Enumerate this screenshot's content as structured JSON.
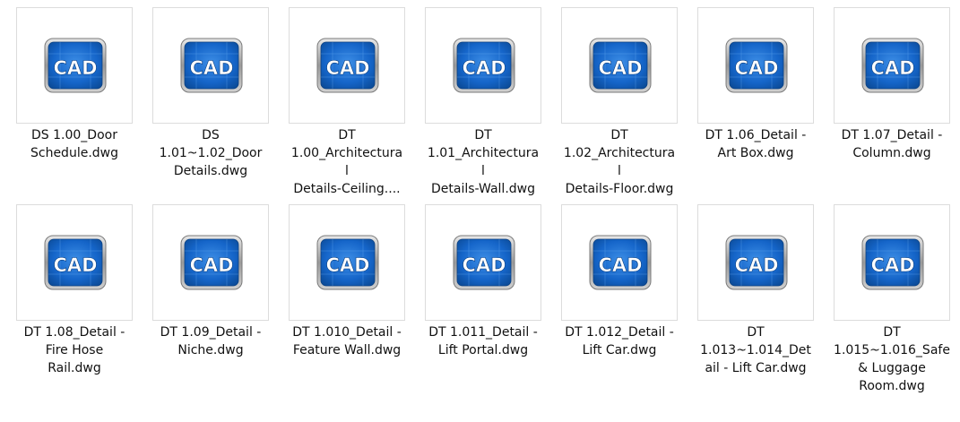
{
  "icon": {
    "name": "cad-file-icon",
    "text": "CAD",
    "color": "#1565c9"
  },
  "files": [
    {
      "lines": [
        "DS 1.00_Door",
        "Schedule.dwg"
      ]
    },
    {
      "lines": [
        "DS",
        "1.01~1.02_Door",
        "Details.dwg"
      ]
    },
    {
      "lines": [
        "DT",
        "1.00_Architectura",
        "l",
        "Details-Ceiling...."
      ]
    },
    {
      "lines": [
        "DT",
        "1.01_Architectura",
        "l",
        "Details-Wall.dwg"
      ]
    },
    {
      "lines": [
        "DT",
        "1.02_Architectura",
        "l",
        "Details-Floor.dwg"
      ]
    },
    {
      "lines": [
        "DT 1.06_Detail -",
        "Art Box.dwg"
      ]
    },
    {
      "lines": [
        "DT 1.07_Detail -",
        "Column.dwg"
      ]
    },
    {
      "lines": [
        "DT 1.08_Detail -",
        "Fire Hose",
        "Rail.dwg"
      ]
    },
    {
      "lines": [
        "DT 1.09_Detail -",
        "Niche.dwg"
      ]
    },
    {
      "lines": [
        "DT 1.010_Detail -",
        "Feature Wall.dwg"
      ]
    },
    {
      "lines": [
        "DT 1.011_Detail -",
        "Lift Portal.dwg"
      ]
    },
    {
      "lines": [
        "DT 1.012_Detail -",
        "Lift Car.dwg"
      ]
    },
    {
      "lines": [
        "DT",
        "1.013~1.014_Det",
        "ail - Lift Car.dwg"
      ]
    },
    {
      "lines": [
        "DT",
        "1.015~1.016_Safe",
        "& Luggage",
        "Room.dwg"
      ]
    }
  ]
}
